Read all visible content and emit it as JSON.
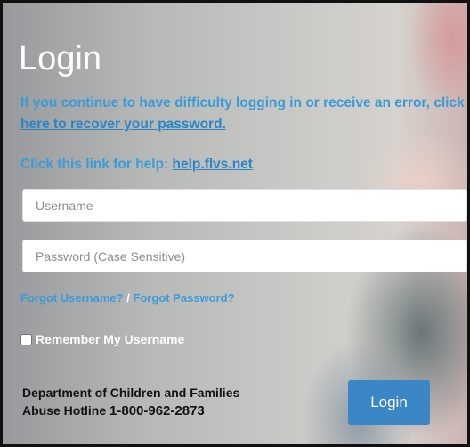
{
  "login": {
    "title": "Login",
    "message_prefix": "If you continue to have difficulty logging in or receive an error, click ",
    "recover_link": "here to recover your password.",
    "help_prefix": "Click this link for help: ",
    "help_link": "help.flvs.net",
    "username_placeholder": "Username",
    "password_placeholder": "Password (Case Sensitive)",
    "forgot_username": "Forgot Username?",
    "forgot_separator": " / ",
    "forgot_password": "Forgot Password?",
    "remember_label": "Remember My Username",
    "dcf_line1": "Department of Children and Families",
    "dcf_line2_prefix": "Abuse Hotline ",
    "dcf_phone": "1-800-962-2873",
    "button_label": "Login"
  },
  "colors": {
    "link_blue": "#3a9bd8",
    "button_blue": "#3b87c6",
    "title_white": "#ffffff"
  }
}
